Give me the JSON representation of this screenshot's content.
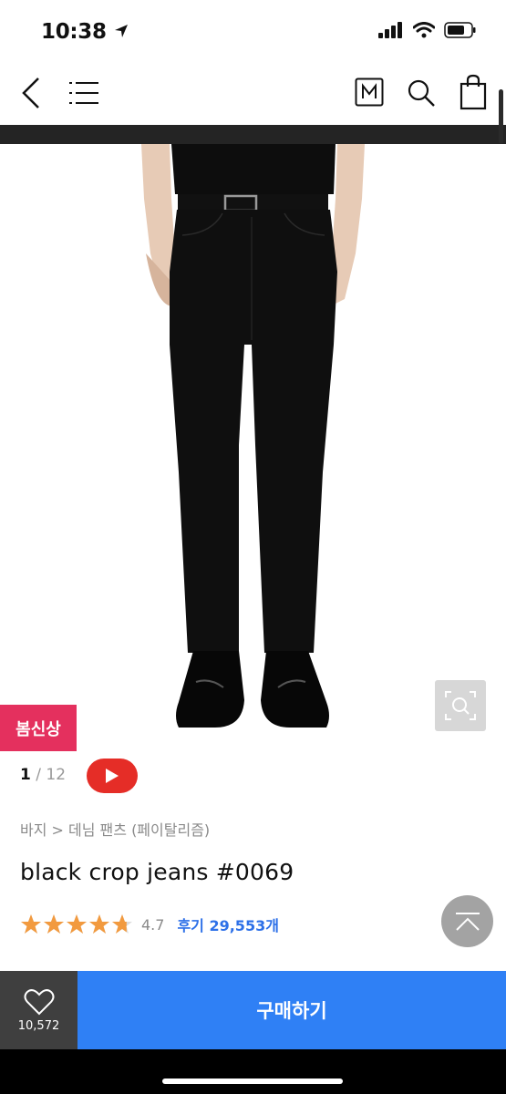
{
  "status_bar": {
    "time": "10:38"
  },
  "product": {
    "badge": "봄신상",
    "pager": {
      "current": "1",
      "total": "/ 12"
    },
    "breadcrumb": "바지 > 데님 팬츠 (페이탈리즘)",
    "title": "black crop jeans #0069",
    "rating": {
      "value": "4.7",
      "stars": 4.7,
      "review_label": "후기 29,553개"
    },
    "accent_colors": {
      "badge": "#e4305e",
      "buy": "#2f80f5",
      "review": "#2d70e8",
      "star": "#f29a3f"
    }
  },
  "nav": {
    "icons": [
      "back-icon",
      "menu-icon",
      "m-store-icon",
      "search-icon",
      "shopping-bag-icon"
    ]
  },
  "bottom_bar": {
    "like_count": "10,572",
    "buy_label": "구매하기"
  }
}
